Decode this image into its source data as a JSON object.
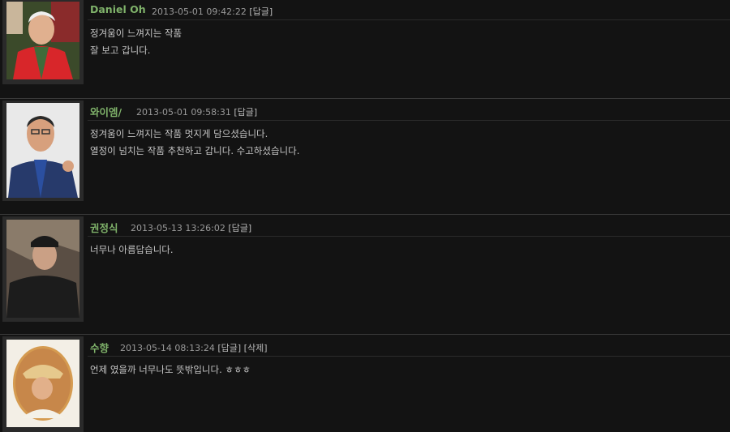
{
  "comments": [
    {
      "author": "Daniel Oh",
      "timestamp": "2013-05-01 09:42:22",
      "reply_label": "[답글]",
      "lines": [
        "정겨움이 느껴지는 작품",
        "잘 보고 갑니다."
      ]
    },
    {
      "author": "와이엠/",
      "timestamp": "2013-05-01 09:58:31",
      "reply_label": "[답글]",
      "lines": [
        "정겨움이 느껴지는 작품 멋지게 담으셨습니다.",
        "열정이 넘치는 작품 추천하고 갑니다. 수고하셨습니다."
      ]
    },
    {
      "author": "권정식",
      "timestamp": "2013-05-13 13:26:02",
      "reply_label": "[답글]",
      "lines": [
        "너무나 아름답습니다."
      ]
    },
    {
      "author": "수향",
      "timestamp": "2013-05-14 08:13:24",
      "reply_label": "[답글]",
      "delete_label": "[삭제]",
      "lines": [
        "언제 였을까 너무나도 뜻밖입니다. ㅎㅎㅎ"
      ]
    }
  ],
  "colors": {
    "background": "#131313",
    "author": "#7fb26a",
    "text": "#c6c6c6",
    "meta": "#9a9a9a"
  }
}
